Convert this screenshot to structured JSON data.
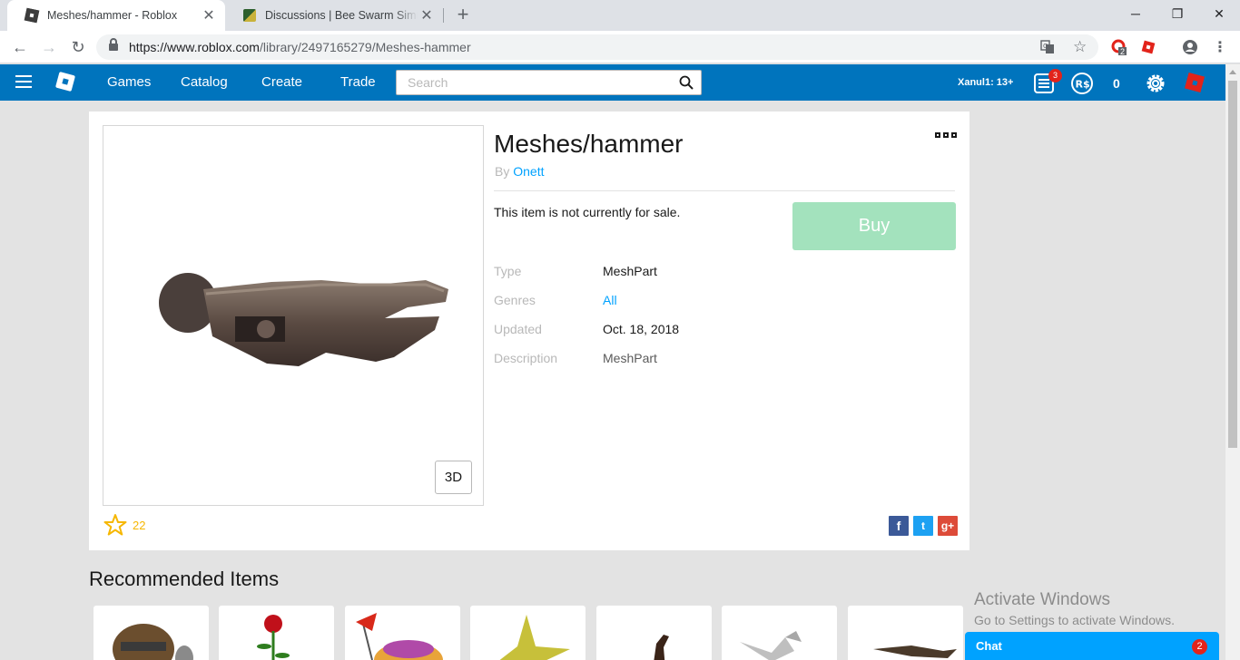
{
  "browser": {
    "tabs": [
      {
        "title": "Meshes/hammer - Roblox",
        "active": true
      },
      {
        "title": "Discussions | Bee Swarm Simulator",
        "active": false
      }
    ],
    "new_tab_label": "+",
    "url_host": "https://www.roblox.com",
    "url_path": "/library/2497165279/Meshes-hammer",
    "extension_badge": "2",
    "window_controls": {
      "minimize": "─",
      "restore": "❐",
      "close": "✕"
    }
  },
  "header": {
    "nav": [
      "Games",
      "Catalog",
      "Create",
      "Trade"
    ],
    "search_placeholder": "Search",
    "username": "Xanul1: 13+",
    "notifications_count": "3",
    "robux_count": "0",
    "colors": {
      "brand_blue": "#0074bd",
      "link_blue": "#00a2ff",
      "buy_green_disabled": "#a3e2bd"
    }
  },
  "item": {
    "title": "Meshes/hammer",
    "by_label": "By",
    "creator": "Onett",
    "sale_status": "This item is not currently for sale.",
    "buy_label": "Buy",
    "view_3d_label": "3D",
    "favorites": "22",
    "fields": [
      {
        "label": "Type",
        "value": "MeshPart",
        "is_link": false
      },
      {
        "label": "Genres",
        "value": "All",
        "is_link": true
      },
      {
        "label": "Updated",
        "value": "Oct. 18, 2018",
        "is_link": false
      },
      {
        "label": "Description",
        "value": "MeshPart",
        "is_link": false
      }
    ],
    "social": [
      "f",
      "t",
      "g+"
    ]
  },
  "recommended": {
    "title": "Recommended Items"
  },
  "watermark": {
    "line1": "Activate Windows",
    "line2": "Go to Settings to activate Windows."
  },
  "chat": {
    "label": "Chat",
    "unread": "2"
  }
}
